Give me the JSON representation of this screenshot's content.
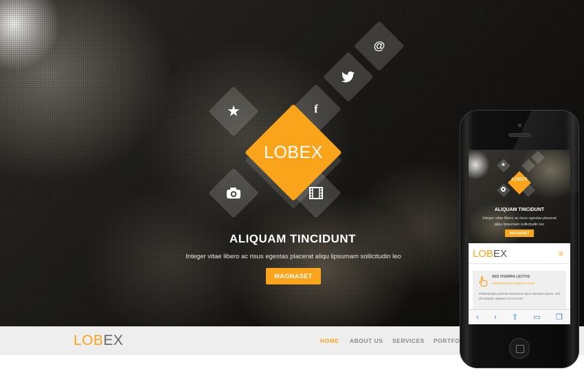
{
  "hero": {
    "logo_text": "LOBEX",
    "title": "ALIQUAM TINCIDUNT",
    "subtitle": "Integer vitae libero ac risus egestas placerat aliqu lipsumam sollicitudin leo",
    "button_label": "MAGNASET",
    "tiles": {
      "star": "★",
      "facebook": "f",
      "twitter": "🐦",
      "pinterest": "@",
      "camera": "◉",
      "film": "▦"
    }
  },
  "nav": {
    "logo_part1": "LOB",
    "logo_part2": "EX",
    "links": [
      "HOME",
      "ABOUT US",
      "SERVICES",
      "PORTFOL"
    ]
  },
  "phone": {
    "hero_logo_text": "LOBEX",
    "hero_title": "ALIQUAM TINCIDUNT",
    "hero_subtitle": "Integer vitae libero ac risus egestas placerat aliqu lipsumam sollicitudin leo",
    "hero_button": "MAGNASET",
    "nav_logo_part1": "LOB",
    "nav_logo_part2": "EX",
    "menu_glyph": "≡",
    "card_title": "SED VIVERRA LECTUS",
    "card_subtitle": "VESTIBULUM VIVERRA ANTE",
    "card_text": "Pellentesque pulvinar fermentum lipus interdum ipsum, sed elit aliquam aliquam os ut cenas",
    "toolbar": [
      "‹",
      "›",
      "⇪",
      "▭",
      "❐"
    ]
  },
  "colors": {
    "accent": "#f9a41b",
    "nav_bg": "#eeeeee",
    "ios_blue": "#2f7de1"
  }
}
